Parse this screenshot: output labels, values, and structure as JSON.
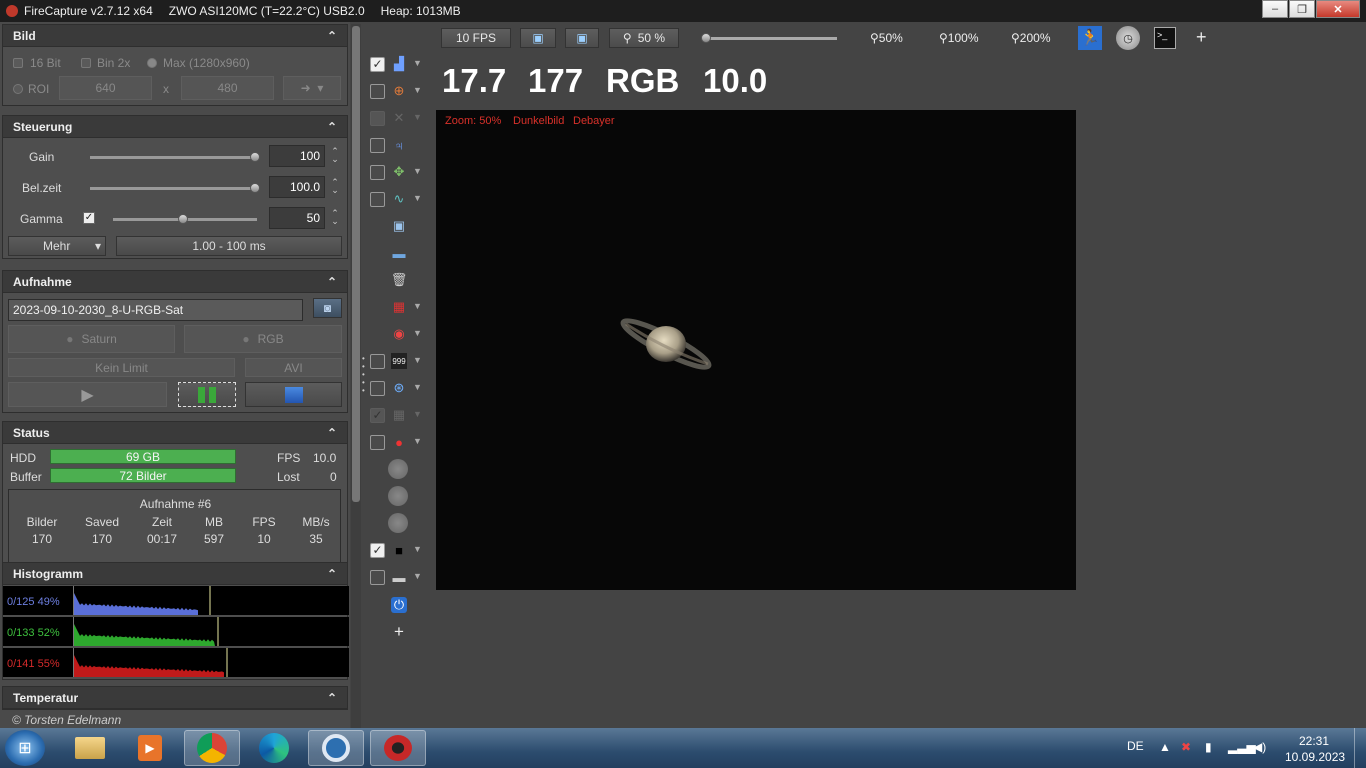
{
  "titlebar": {
    "app": "FireCapture v2.7.12 x64",
    "camera": "ZWO ASI120MC (T=22.2°C) USB2.0",
    "heap": "Heap: 1013MB",
    "min": "‒",
    "restore": "❐",
    "close": "✕"
  },
  "bild": {
    "title": "Bild",
    "bit16": "16 Bit",
    "bin2x": "Bin 2x",
    "max": "Max (1280x960)",
    "roi": "ROI",
    "roi_w": "640",
    "x": "x",
    "roi_h": "480"
  },
  "steuerung": {
    "title": "Steuerung",
    "gain_label": "Gain",
    "gain_value": "100",
    "belzeit_label": "Bel.zeit",
    "belzeit_value": "100.0",
    "gamma_label": "Gamma",
    "gamma_value": "50",
    "mehr": "Mehr",
    "range": "1.00 - 100 ms"
  },
  "aufnahme": {
    "title": "Aufnahme",
    "filename": "2023-09-10-2030_8-U-RGB-Sat",
    "object": "Saturn",
    "color": "RGB",
    "limit": "Kein Limit",
    "format": "AVI"
  },
  "status": {
    "title": "Status",
    "hdd_label": "HDD",
    "hdd_value": "69 GB",
    "buffer_label": "Buffer",
    "buffer_value": "72 Bilder",
    "fps_label": "FPS",
    "fps_value": "10.0",
    "lost_label": "Lost",
    "lost_value": "0",
    "capture_title": "Aufnahme #6",
    "cols": [
      "Bilder",
      "Saved",
      "Zeit",
      "MB",
      "FPS",
      "MB/s"
    ],
    "vals": [
      "170",
      "170",
      "00:17",
      "597",
      "10",
      "35"
    ]
  },
  "histogramm": {
    "title": "Histogramm",
    "blue": "0/125 49%",
    "green": "0/133 52%",
    "red": "0/141 55%",
    "colors": {
      "blue": "#5a6fd8",
      "green": "#2ea82e",
      "red": "#c01a1a"
    }
  },
  "temperatur": {
    "title": "Temperatur"
  },
  "copyright": "© Torsten Edelmann",
  "toolbar": {
    "fps": "10 FPS",
    "zoom": "50 %",
    "z50": "50%",
    "z100": "100%",
    "z200": "200%",
    "plus": "+"
  },
  "stats": {
    "a": "17.7",
    "b": "177",
    "c": "RGB",
    "d": "10.0"
  },
  "overlay": {
    "zoom": "Zoom: 50%",
    "dark": "Dunkelbild",
    "debayer": "Debayer"
  },
  "sidebar": {
    "plus": "+",
    "counter_icon": "999"
  },
  "tray": {
    "lang": "DE",
    "time": "22:31",
    "date": "10.09.2023"
  },
  "taskbar": {
    "items": [
      "start-orb",
      "file-explorer-icon",
      "media-player-icon",
      "chrome-icon",
      "edge-icon",
      "app-circle-icon",
      "firecapture-icon"
    ]
  }
}
